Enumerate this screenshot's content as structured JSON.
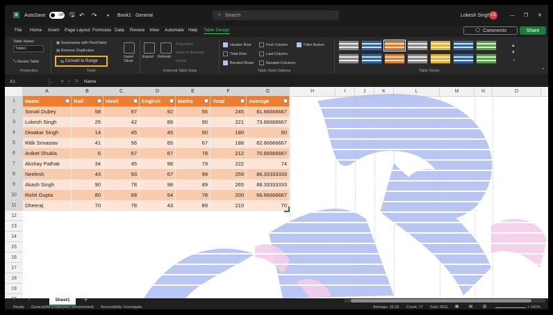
{
  "titlebar": {
    "autosave": "AutoSave",
    "toggle": "Off",
    "filename": "Book1 · General",
    "search_placeholder": "Search",
    "user_name": "Lokesh Singh",
    "user_initials": "LS",
    "minimize": "—",
    "restore": "❐",
    "close": "✕"
  },
  "menu": {
    "tabs": [
      "File",
      "Home",
      "Insert",
      "Page Layout",
      "Formulas",
      "Data",
      "Review",
      "View",
      "Automate",
      "Help",
      "Table Design"
    ],
    "active": "Table Design",
    "comments": "Comments",
    "share": "Share"
  },
  "ribbon": {
    "table_name_label": "Table Name:",
    "table_name_value": "Table1",
    "resize_table": "Resize Table",
    "properties_label": "Properties",
    "summarize": "Summarize with PivotTable",
    "remove_duplicates": "Remove Duplicates",
    "convert_to_range": "Convert to Range",
    "insert_slicer": "Insert Slicer",
    "tools_label": "Tools",
    "export": "Export",
    "refresh": "Refresh",
    "properties_btn": "Properties",
    "open_browser": "Open in Browser",
    "unlink": "Unlink",
    "external_label": "External Table Data",
    "header_row": "Header Row",
    "total_row": "Total Row",
    "banded_rows": "Banded Rows",
    "first_column": "First Column",
    "last_column": "Last Column",
    "banded_columns": "Banded Columns",
    "filter_button": "Filter Button",
    "style_options_label": "Table Style Options",
    "styles_label": "Table Styles"
  },
  "formula_bar": {
    "cell_ref": "A1",
    "fx": "fx",
    "content": "Name"
  },
  "columns": [
    "A",
    "B",
    "C",
    "D",
    "E",
    "F",
    "G",
    "H",
    "I",
    "J",
    "K",
    "L",
    "M",
    "N",
    "O"
  ],
  "rows": [
    "1",
    "2",
    "3",
    "4",
    "5",
    "6",
    "7",
    "8",
    "9",
    "10",
    "11",
    "12",
    "13",
    "14",
    "15",
    "16",
    "17",
    "18",
    "19",
    "20",
    "21"
  ],
  "table": {
    "headers": [
      "Name",
      "Roll",
      "Hindi",
      "English",
      "Maths",
      "Total",
      "Average"
    ],
    "rows": [
      [
        "Sonali Dubey",
        "58",
        "97",
        "92",
        "56",
        "245",
        "81.66666667"
      ],
      [
        "Lokesh Singh",
        "25",
        "42",
        "89",
        "90",
        "221",
        "73.66666667"
      ],
      [
        "Diwakar Singh",
        "14",
        "45",
        "45",
        "90",
        "180",
        "60"
      ],
      [
        "Ritik Srivastav",
        "41",
        "56",
        "65",
        "67",
        "188",
        "62.66666667"
      ],
      [
        "Aniket Shukla",
        "6",
        "67",
        "67",
        "78",
        "212",
        "70.66666667"
      ],
      [
        "Akshay Pathak",
        "34",
        "45",
        "98",
        "79",
        "222",
        "74"
      ],
      [
        "Neelesh",
        "43",
        "93",
        "67",
        "99",
        "259",
        "86.33333333"
      ],
      [
        "Akash Singh",
        "90",
        "78",
        "98",
        "89",
        "265",
        "88.33333333"
      ],
      [
        "Rohit Gupta",
        "80",
        "68",
        "54",
        "78",
        "200",
        "66.66666667"
      ],
      [
        "Dheeraj",
        "70",
        "78",
        "43",
        "89",
        "210",
        "70"
      ]
    ]
  },
  "sheets": {
    "active": "Sheet1",
    "add": "+"
  },
  "status": {
    "ready": "Ready",
    "sensitivity": "General\\All Employees (unrestricted)",
    "accessibility": "Accessibility: Investigate",
    "average": "Average: 15.33",
    "count": "Count: 77",
    "sum": "Sum: 5611",
    "zoom": "+ 141%"
  },
  "colors": {
    "table_header": "#ed7d31",
    "band_dark": "#f8cbad",
    "band_light": "#fce4d6",
    "accent": "#1d7a45",
    "highlight_border": "#f0b429"
  }
}
